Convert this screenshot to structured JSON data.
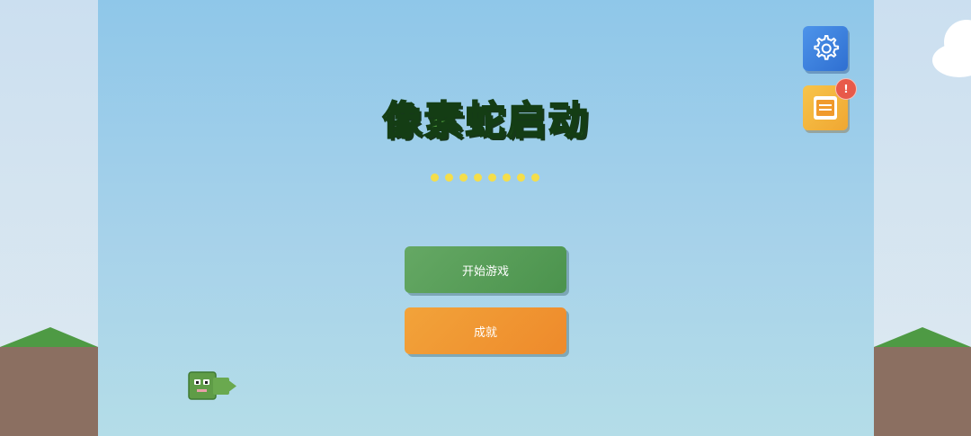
{
  "game": {
    "title": "像素蛇启动",
    "loading_dots": 8,
    "buttons": {
      "start": "开始游戏",
      "achievements": "成就"
    },
    "notice_badge": "!"
  },
  "colors": {
    "sky_top": "#8fc7e9",
    "title_fill": "#4f9a3e",
    "start_button": "#5a9e5a",
    "achievements_button": "#f09a35",
    "settings_button": "#3b7fdc",
    "notice_button": "#f4b33d",
    "badge": "#e85a4a",
    "dots": "#f5de4a"
  },
  "icons": [
    "gear-icon",
    "notice-board-icon",
    "snake-sprite"
  ]
}
